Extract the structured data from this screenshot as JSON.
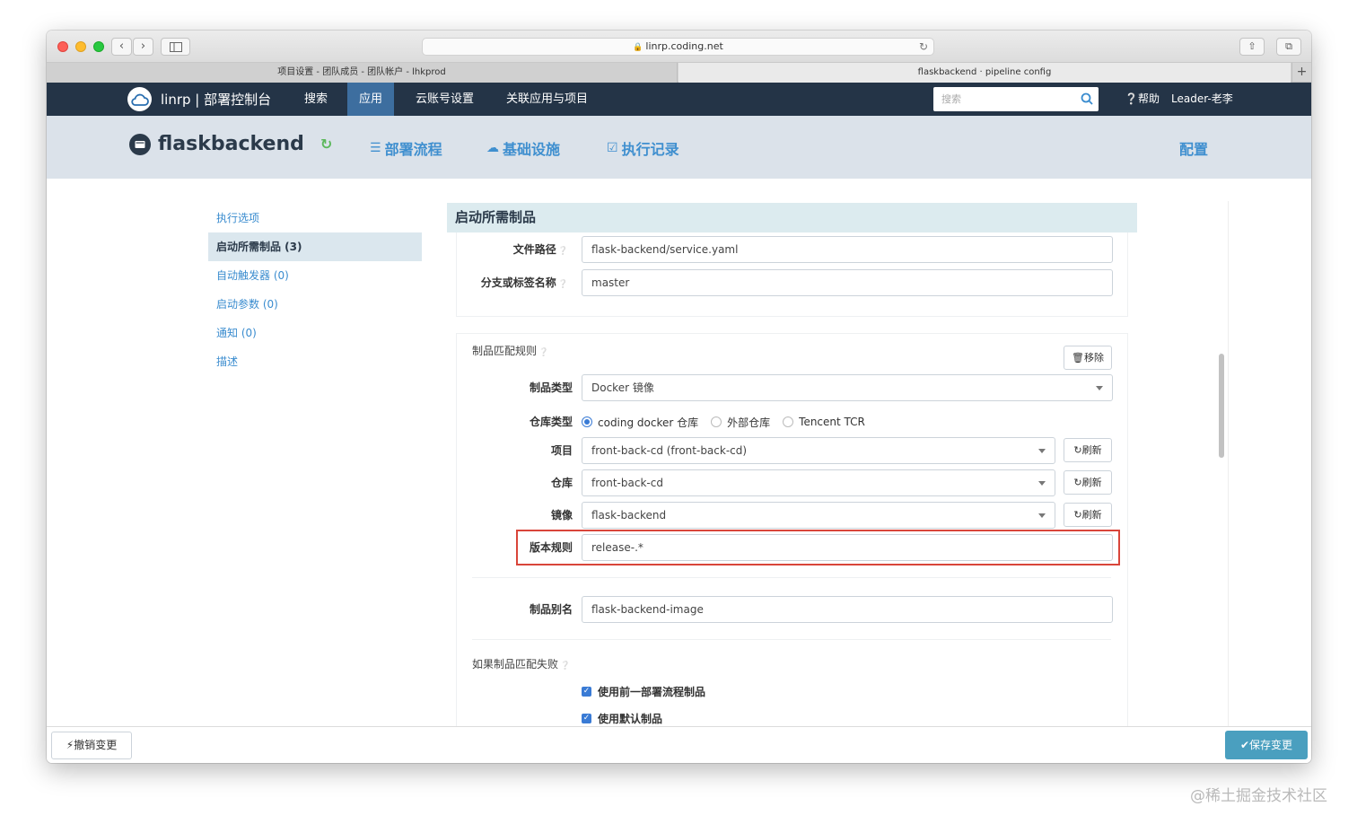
{
  "browser": {
    "url": "linrp.coding.net",
    "tabs": [
      {
        "label": "项目设置 - 团队成员 - 团队帐户 - lhkprod"
      },
      {
        "label": "flaskbackend · pipeline config"
      }
    ]
  },
  "topnav": {
    "brand": "linrp | 部署控制台",
    "items": [
      {
        "label": "搜索"
      },
      {
        "label": "应用",
        "active": true
      },
      {
        "label": "云账号设置"
      },
      {
        "label": "关联应用与项目"
      }
    ],
    "search_placeholder": "搜索",
    "help": "帮助",
    "user": "Leader-老李"
  },
  "app": {
    "name": "flaskbackend",
    "tabs": [
      {
        "label": "部署流程",
        "icon": "list-icon"
      },
      {
        "label": "基础设施",
        "icon": "cloud-icon"
      },
      {
        "label": "执行记录",
        "icon": "check-square-icon"
      }
    ],
    "config": "配置"
  },
  "sidebar": {
    "items": [
      {
        "label": "执行选项"
      },
      {
        "label": "启动所需制品 (3)",
        "active": true
      },
      {
        "label": "自动触发器 (0)"
      },
      {
        "label": "启动参数 (0)"
      },
      {
        "label": "通知 (0)"
      },
      {
        "label": "描述"
      }
    ]
  },
  "section": {
    "title": "启动所需制品",
    "file_path_label": "文件路径",
    "file_path_value": "flask-backend/service.yaml",
    "branch_label": "分支或标签名称",
    "branch_value": "master"
  },
  "rule": {
    "title": "制品匹配规则",
    "remove_label": "移除",
    "type_label": "制品类型",
    "type_value": "Docker 镜像",
    "repo_type_label": "仓库类型",
    "repo_type_options": [
      {
        "label": "coding docker 仓库",
        "selected": true
      },
      {
        "label": "外部仓库",
        "selected": false
      },
      {
        "label": "Tencent TCR",
        "selected": false
      }
    ],
    "project_label": "项目",
    "project_value": "front-back-cd (front-back-cd)",
    "repo_label": "仓库",
    "repo_value": "front-back-cd",
    "image_label": "镜像",
    "image_value": "flask-backend",
    "refresh_label": "刷新",
    "version_label": "版本规则",
    "version_value": "release-.*",
    "alias_label": "制品别名",
    "alias_value": "flask-backend-image",
    "fail_title": "如果制品匹配失败",
    "fail_options": [
      {
        "label": "使用前一部署流程制品",
        "checked": true
      },
      {
        "label": "使用默认制品",
        "checked": true
      }
    ]
  },
  "footer": {
    "undo_label": "撤销变更",
    "save_label": "保存变更"
  },
  "watermark": "@稀土掘金技术社区",
  "colors": {
    "navbar": "#243447",
    "nav_active": "#3d6e9f",
    "link": "#3a8ccf",
    "highlight": "#d9453a",
    "save": "#4a9fbf"
  }
}
